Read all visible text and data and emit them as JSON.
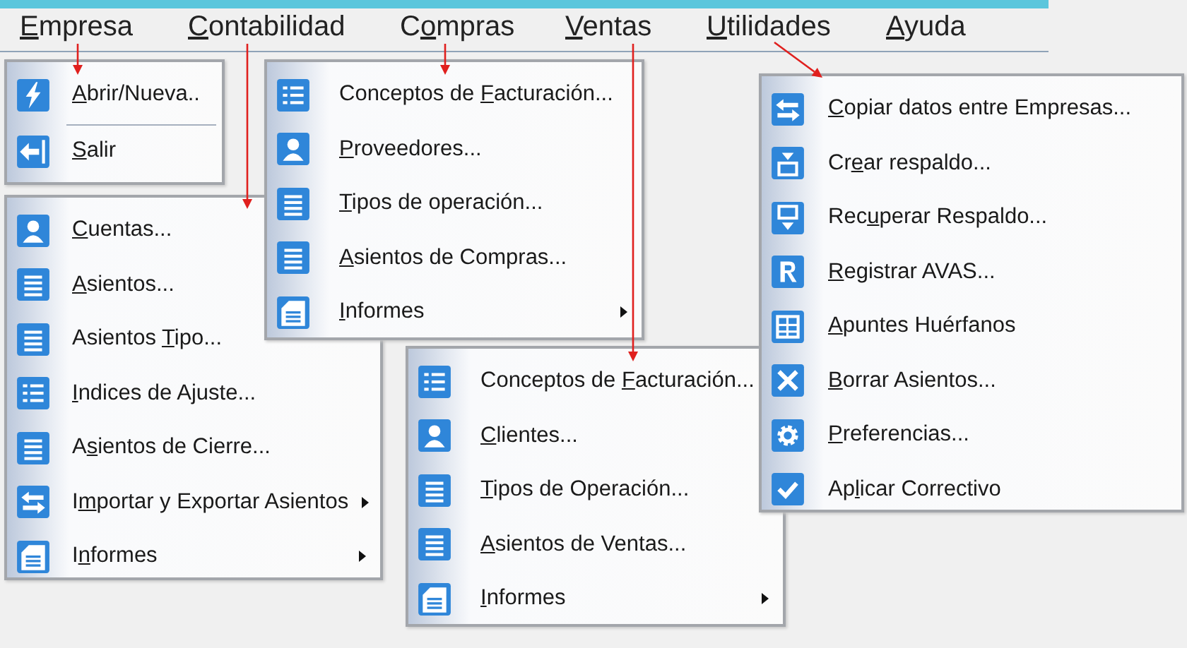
{
  "menu_bar": [
    {
      "access_key": "E",
      "label_end": "mpresa"
    },
    {
      "access_key": "C",
      "label_end": "ontabilidad"
    },
    {
      "label_start": "C",
      "access_key": "o",
      "label_end": "mpras"
    },
    {
      "access_key": "V",
      "label_end": "entas"
    },
    {
      "access_key": "U",
      "label_end": "tilidades"
    },
    {
      "access_key": "A",
      "label_end": "yuda"
    }
  ],
  "menus": [
    {
      "items": [
        {
          "access_key": "A",
          "label_end": "brir/Nueva..",
          "submenu": false
        },
        {
          "access_key": "S",
          "label_end": "alir",
          "submenu": false
        }
      ]
    },
    {
      "items": [
        {
          "access_key": "C",
          "label_end": "uentas...",
          "submenu": false
        },
        {
          "access_key": "A",
          "label_end": "sientos...",
          "submenu": false
        },
        {
          "label_start": "Asientos ",
          "access_key": "T",
          "label_end": "ipo...",
          "submenu": false
        },
        {
          "access_key": "I",
          "label_end": "ndices de Ajuste...",
          "submenu": false
        },
        {
          "label_start": "A",
          "access_key": "s",
          "label_end": "ientos de Cierre...",
          "submenu": false
        },
        {
          "label_start": "I",
          "access_key": "m",
          "label_end": "portar y Exportar Asientos",
          "submenu": true
        },
        {
          "label_start": "I",
          "access_key": "n",
          "label_end": "formes",
          "submenu": true
        }
      ]
    },
    {
      "items": [
        {
          "label_start": "Conceptos de ",
          "access_key": "F",
          "label_end": "acturación...",
          "submenu": false
        },
        {
          "access_key": "P",
          "label_end": "roveedores...",
          "submenu": false
        },
        {
          "access_key": "T",
          "label_end": "ipos de operación...",
          "submenu": false
        },
        {
          "access_key": "A",
          "label_end": "sientos de Compras...",
          "submenu": false
        },
        {
          "access_key": "I",
          "label_end": "nformes",
          "submenu": true
        }
      ]
    },
    {
      "items": [
        {
          "label_start": "Conceptos de ",
          "access_key": "F",
          "label_end": "acturación...",
          "submenu": false
        },
        {
          "access_key": "C",
          "label_end": "lientes...",
          "submenu": false
        },
        {
          "access_key": "T",
          "label_end": "ipos de Operación...",
          "submenu": false
        },
        {
          "access_key": "A",
          "label_end": "sientos de Ventas...",
          "submenu": false
        },
        {
          "access_key": "I",
          "label_end": "nformes",
          "submenu": true
        }
      ]
    },
    {
      "items": [
        {
          "access_key": "C",
          "label_end": "opiar datos entre Empresas...",
          "submenu": false
        },
        {
          "label_start": "Cr",
          "access_key": "e",
          "label_end": "ar respaldo...",
          "submenu": false
        },
        {
          "label_start": "Rec",
          "access_key": "u",
          "label_end": "perar Respaldo...",
          "submenu": false
        },
        {
          "access_key": "R",
          "label_end": "egistrar AVAS...",
          "submenu": false
        },
        {
          "access_key": "A",
          "label_end": "puntes Huérfanos",
          "submenu": false
        },
        {
          "access_key": "B",
          "label_end": "orrar Asientos...",
          "submenu": false
        },
        {
          "access_key": "P",
          "label_end": "referencias...",
          "submenu": false
        },
        {
          "label_start": "Ap",
          "access_key": "l",
          "label_end": "icar Correctivo",
          "submenu": false
        }
      ]
    }
  ]
}
